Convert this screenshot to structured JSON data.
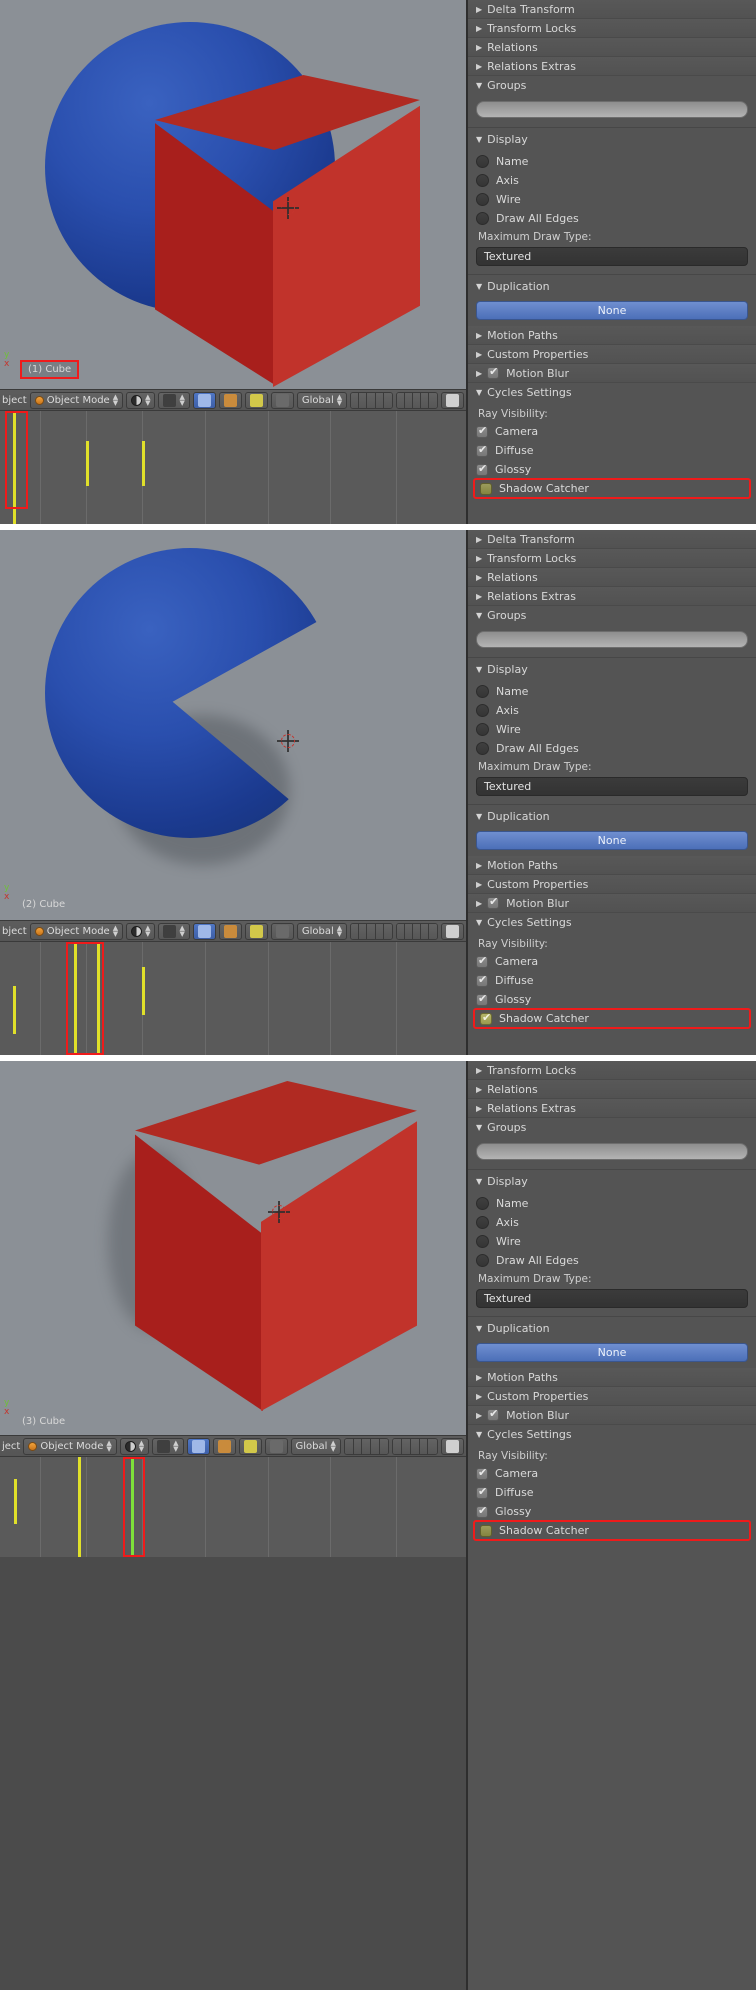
{
  "app": {
    "name": "Blender",
    "editor": "3D View + Properties"
  },
  "panels": [
    {
      "id": "panel-1",
      "object_label": "(1) Cube",
      "object_label_highlighted": true,
      "viewport": {
        "objects": [
          "blue-sphere",
          "red-cube"
        ],
        "shadow_visible": false,
        "cursor": "3d-cursor"
      },
      "header": {
        "editor_label": "bject",
        "mode": "Object Mode",
        "transform_orientation": "Global"
      },
      "properties": {
        "collapsed_sections": [
          "Delta Transform",
          "Transform Locks",
          "Relations",
          "Relations Extras"
        ],
        "groups": {
          "title": "Groups",
          "field_value": ""
        },
        "display": {
          "title": "Display",
          "checkboxes": [
            {
              "label": "Name",
              "checked": false
            },
            {
              "label": "Axis",
              "checked": false
            },
            {
              "label": "Wire",
              "checked": false
            },
            {
              "label": "Draw All Edges",
              "checked": false
            }
          ],
          "max_draw_type_label": "Maximum Draw Type:",
          "max_draw_type_value": "Textured"
        },
        "duplication": {
          "title": "Duplication",
          "value": "None"
        },
        "motion_paths": "Motion Paths",
        "custom_properties": "Custom Properties",
        "motion_blur": {
          "label": "Motion Blur",
          "checked": true
        },
        "cycles_settings": {
          "title": "Cycles Settings",
          "ray_visibility_label": "Ray Visibility:",
          "items": [
            {
              "label": "Camera",
              "checked": true,
              "style": "grey"
            },
            {
              "label": "Diffuse",
              "checked": true,
              "style": "grey"
            },
            {
              "label": "Glossy",
              "checked": true,
              "style": "grey"
            },
            {
              "label": "Shadow Catcher",
              "checked": false,
              "style": "olive",
              "highlighted": true
            }
          ]
        }
      },
      "timeline": {
        "keyframes": [
          14,
          86,
          142
        ],
        "selection_box": true
      }
    },
    {
      "id": "panel-2",
      "object_label": "(2) Cube",
      "object_label_highlighted": false,
      "viewport": {
        "objects": [
          "blue-sphere-pacman",
          "shadow-catcher-notch"
        ],
        "shadow_visible": true,
        "cursor": "3d-cursor"
      },
      "header": {
        "editor_label": "bject",
        "mode": "Object Mode",
        "transform_orientation": "Global"
      },
      "properties": {
        "collapsed_sections": [
          "Delta Transform",
          "Transform Locks",
          "Relations",
          "Relations Extras"
        ],
        "groups": {
          "title": "Groups",
          "field_value": ""
        },
        "display": {
          "title": "Display",
          "checkboxes": [
            {
              "label": "Name",
              "checked": false
            },
            {
              "label": "Axis",
              "checked": false
            },
            {
              "label": "Wire",
              "checked": false
            },
            {
              "label": "Draw All Edges",
              "checked": false
            }
          ],
          "max_draw_type_label": "Maximum Draw Type:",
          "max_draw_type_value": "Textured"
        },
        "duplication": {
          "title": "Duplication",
          "value": "None"
        },
        "motion_paths": "Motion Paths",
        "custom_properties": "Custom Properties",
        "motion_blur": {
          "label": "Motion Blur",
          "checked": true
        },
        "cycles_settings": {
          "title": "Cycles Settings",
          "ray_visibility_label": "Ray Visibility:",
          "items": [
            {
              "label": "Camera",
              "checked": true,
              "style": "grey"
            },
            {
              "label": "Diffuse",
              "checked": true,
              "style": "grey"
            },
            {
              "label": "Glossy",
              "checked": true,
              "style": "grey"
            },
            {
              "label": "Shadow Catcher",
              "checked": true,
              "style": "olive",
              "highlighted": true
            }
          ]
        }
      },
      "timeline": {
        "keyframes": [
          74,
          86,
          142
        ],
        "selection_box": true
      }
    },
    {
      "id": "panel-3",
      "object_label": "(3) Cube",
      "object_label_highlighted": false,
      "viewport": {
        "objects": [
          "red-cube"
        ],
        "shadow_visible": true,
        "cursor": "3d-cursor"
      },
      "header": {
        "editor_label": "ject",
        "mode": "Object Mode",
        "transform_orientation": "Global"
      },
      "properties": {
        "collapsed_sections": [
          "Transform Locks",
          "Relations",
          "Relations Extras"
        ],
        "groups": {
          "title": "Groups",
          "field_value": ""
        },
        "display": {
          "title": "Display",
          "checkboxes": [
            {
              "label": "Name",
              "checked": false
            },
            {
              "label": "Axis",
              "checked": false
            },
            {
              "label": "Wire",
              "checked": false
            },
            {
              "label": "Draw All Edges",
              "checked": false
            }
          ],
          "max_draw_type_label": "Maximum Draw Type:",
          "max_draw_type_value": "Textured"
        },
        "duplication": {
          "title": "Duplication",
          "value": "None"
        },
        "motion_paths": "Motion Paths",
        "custom_properties": "Custom Properties",
        "motion_blur": {
          "label": "Motion Blur",
          "checked": true
        },
        "cycles_settings": {
          "title": "Cycles Settings",
          "ray_visibility_label": "Ray Visibility:",
          "items": [
            {
              "label": "Camera",
              "checked": true,
              "style": "grey"
            },
            {
              "label": "Diffuse",
              "checked": true,
              "style": "grey"
            },
            {
              "label": "Glossy",
              "checked": true,
              "style": "grey"
            },
            {
              "label": "Shadow Catcher",
              "checked": false,
              "style": "olive",
              "highlighted": true
            }
          ]
        }
      },
      "timeline": {
        "keyframes": [
          78,
          130
        ],
        "selection_box": true,
        "green_key": 130
      }
    }
  ],
  "colors": {
    "viewport_bg": "#8b9096",
    "cube_red": "#b32222",
    "sphere_blue": "#2a4fae",
    "highlight_red": "#ef1b1b",
    "duplication_blue": "#4c6fb8",
    "checkbox_olive": "#9b9b4e",
    "keyframe_yellow": "#e0e02a",
    "panel_bg": "#545454"
  }
}
